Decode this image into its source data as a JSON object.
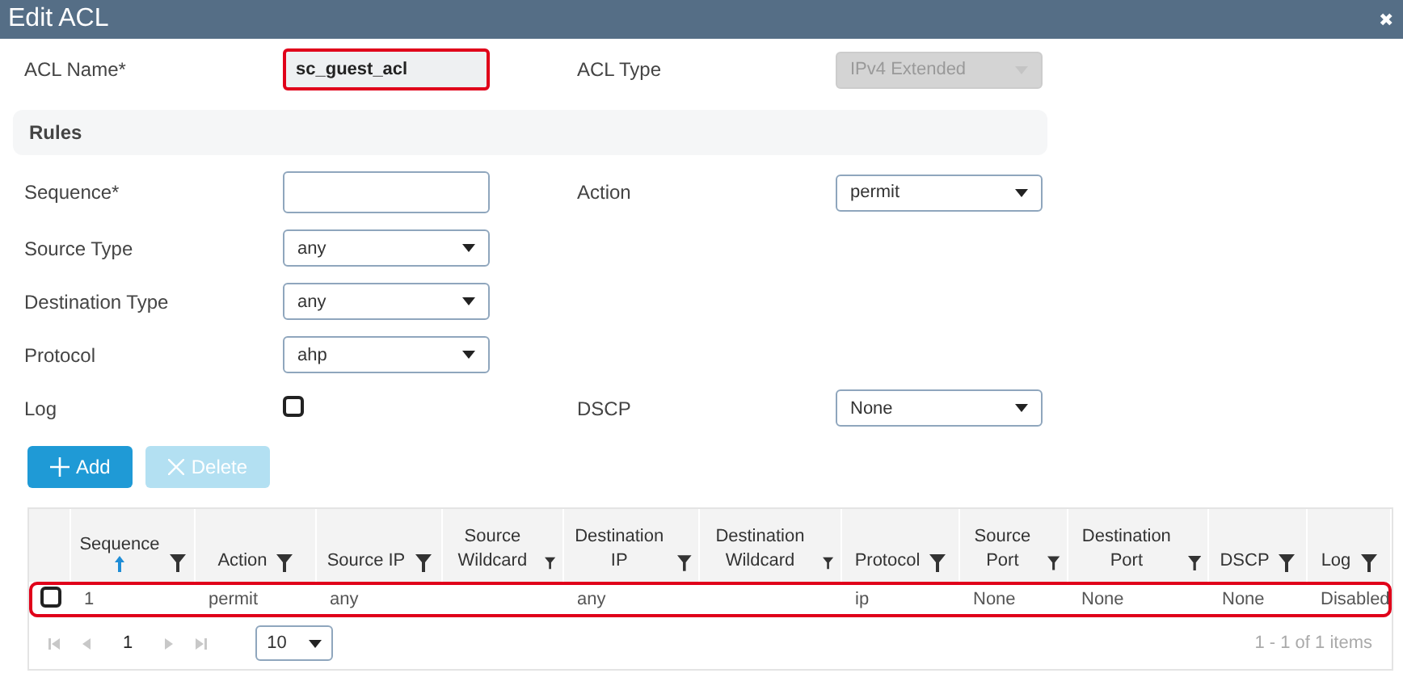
{
  "window": {
    "title": "Edit ACL",
    "close": "✖"
  },
  "header_fields": [
    {
      "label": "ACL Name*",
      "kind": "text",
      "value": "sc_guest_acl",
      "highlighted": true
    },
    {
      "label": "ACL Type",
      "kind": "select",
      "value": "IPv4 Extended",
      "disabled": true
    }
  ],
  "rules": {
    "title": "Rules",
    "fields": [
      {
        "label": "Sequence*",
        "kind": "text"
      },
      {
        "label": "Action",
        "kind": "select",
        "value": "permit"
      },
      {
        "label": "Source Type",
        "kind": "select",
        "value": "any"
      },
      {
        "label": "Destination Type",
        "kind": "select",
        "value": "any"
      },
      {
        "label": "Protocol",
        "kind": "select",
        "value": "ahp"
      },
      {
        "label": "Log",
        "kind": "checkbox",
        "checked": false
      },
      {
        "label": "DSCP",
        "kind": "select",
        "value": "None"
      }
    ]
  },
  "buttons": [
    {
      "label": "Add",
      "kind": "add",
      "disabled": false
    },
    {
      "label": "Delete",
      "kind": "delete",
      "disabled": true
    }
  ],
  "table": {
    "columns": [
      {
        "label": "Sequence",
        "sorted": true
      },
      {
        "label": "Action",
        "sorted": false
      },
      {
        "label": "Source IP",
        "sorted": false
      },
      {
        "label": "Source Wildcard",
        "sorted": false
      },
      {
        "label": "Destination IP",
        "sorted": false
      },
      {
        "label": "Destination Wildcard",
        "sorted": false
      },
      {
        "label": "Protocol",
        "sorted": false
      },
      {
        "label": "Source Port",
        "sorted": false
      },
      {
        "label": "Destination Port",
        "sorted": false
      },
      {
        "label": "DSCP",
        "sorted": false
      },
      {
        "label": "Log",
        "sorted": false
      }
    ],
    "rows": [
      {
        "checked": false,
        "highlighted": true,
        "cells": [
          "1",
          "permit",
          "any",
          "",
          "any",
          "",
          "ip",
          "None",
          "None",
          "None",
          "Disabled"
        ]
      }
    ],
    "pager": {
      "page": "1",
      "page_size": "10",
      "summary": "1 - 1 of 1 items"
    }
  }
}
